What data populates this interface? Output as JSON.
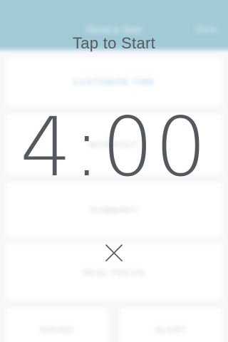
{
  "background": {
    "header_title": "Reset & Start",
    "header_action": "Done",
    "cards": [
      {
        "label": "CUSTOMIZE TIME",
        "accent": true
      },
      {
        "label": "WORKOUT",
        "accent": false
      },
      {
        "label": "SUMMARY",
        "accent": false
      },
      {
        "label": "REAL FOCUS",
        "accent": false
      },
      {
        "label": "SOUND",
        "accent": false
      },
      {
        "label": "ALERT",
        "accent": false
      }
    ]
  },
  "overlay": {
    "tap_label": "Tap to Start",
    "timer_value": "4:00",
    "close_icon": "close-x-icon"
  },
  "colors": {
    "header": "#6aaabd",
    "text": "#55595e",
    "accent": "#78b1cf"
  }
}
